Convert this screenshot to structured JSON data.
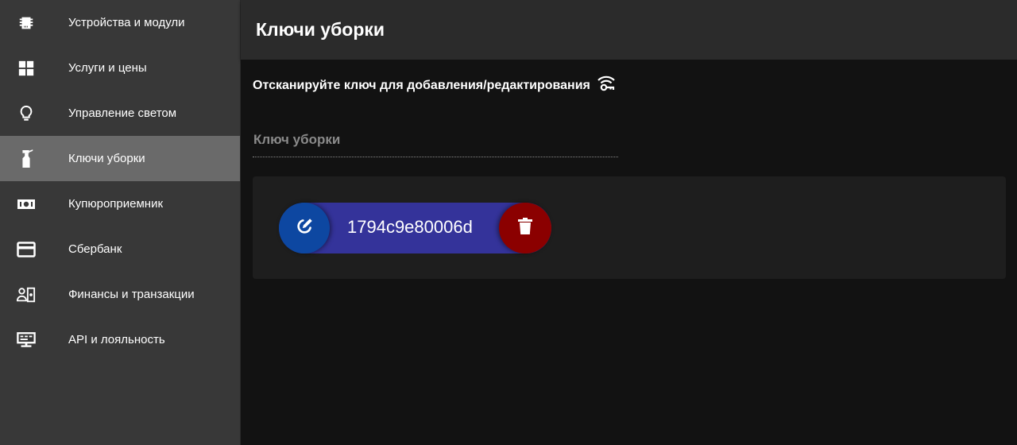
{
  "sidebar": {
    "items": [
      {
        "label": "Устройства и модули",
        "icon": "chip-icon",
        "active": false
      },
      {
        "label": "Услуги и цены",
        "icon": "grid-icon",
        "active": false
      },
      {
        "label": "Управление светом",
        "icon": "lightbulb-icon",
        "active": false
      },
      {
        "label": "Ключи уборки",
        "icon": "spray-bottle-icon",
        "active": true
      },
      {
        "label": "Купюроприемник",
        "icon": "banknote-icon",
        "active": false
      },
      {
        "label": "Сбербанк",
        "icon": "credit-card-icon",
        "active": false
      },
      {
        "label": "Финансы и транзакции",
        "icon": "account-cash-icon",
        "active": false
      },
      {
        "label": "API и лояльность",
        "icon": "api-monitor-icon",
        "active": false
      }
    ]
  },
  "header": {
    "title": "Ключи уборки"
  },
  "main": {
    "scan_hint": "Отсканируйте ключ для добавления/редактирования",
    "scan_icon": "wifi-key-icon",
    "key_field": {
      "placeholder": "Ключ уборки",
      "value": ""
    },
    "keys": [
      {
        "value": "1794c9e80006d"
      }
    ]
  },
  "colors": {
    "sidebar_bg": "#383838",
    "sidebar_active": "#6a6a6a",
    "header_bg": "#2b2b2b",
    "main_bg": "#121212",
    "card_bg": "#1e1e1e",
    "chip_bg": "#34339a",
    "edit_button": "#0d47a1",
    "delete_button": "#8b0000"
  }
}
